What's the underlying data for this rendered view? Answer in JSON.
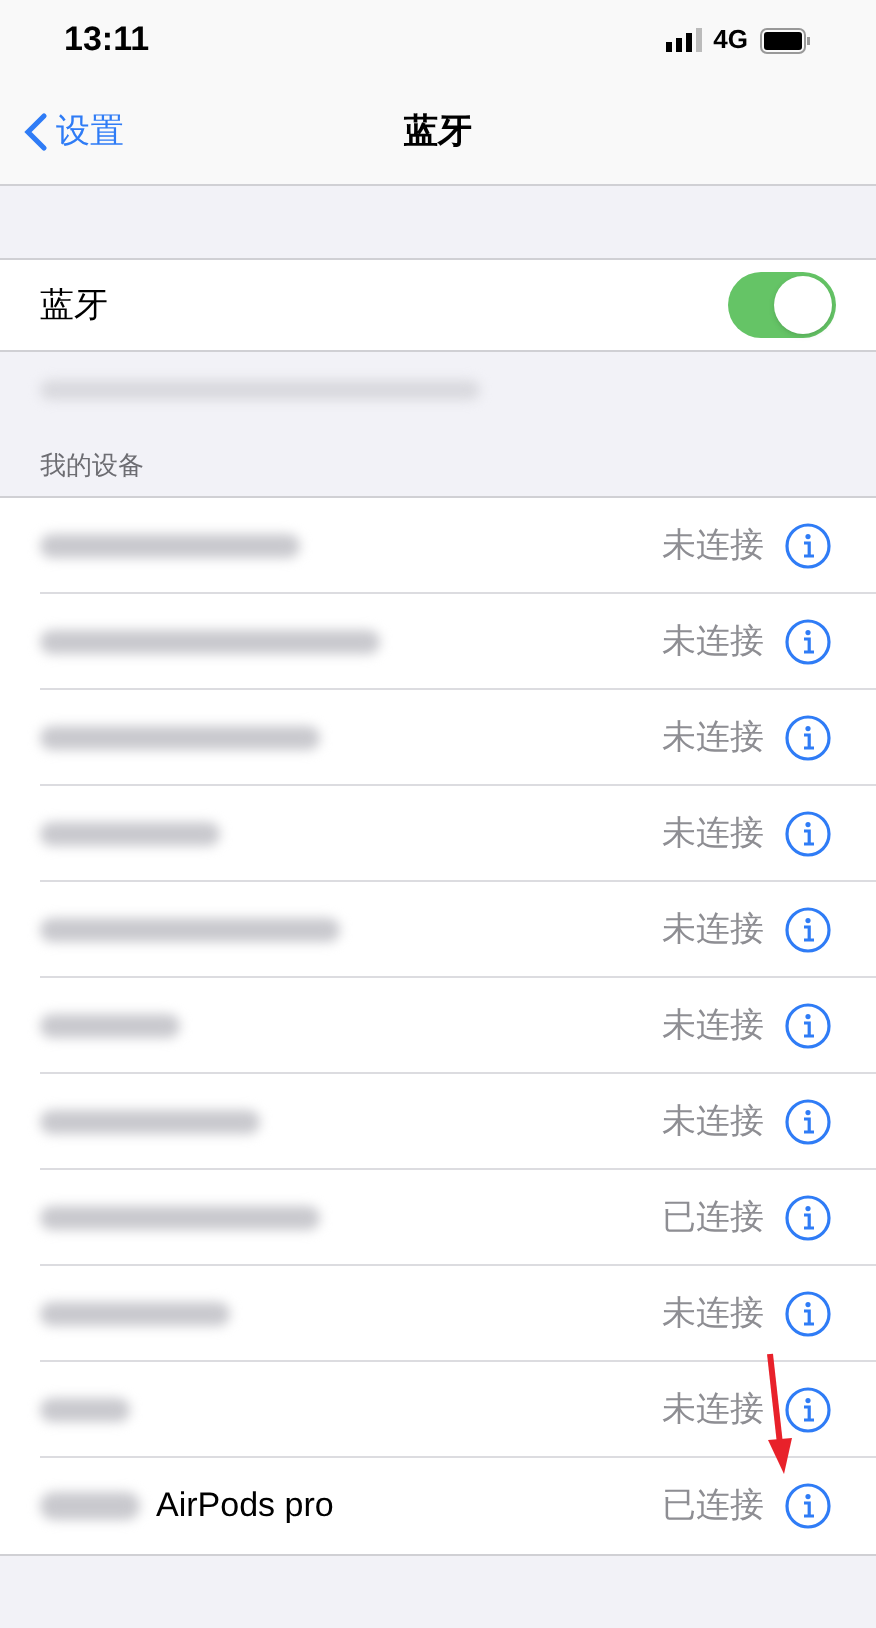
{
  "status_bar": {
    "time": "13:11",
    "network": "4G"
  },
  "nav": {
    "back": "设置",
    "title": "蓝牙"
  },
  "bluetooth": {
    "label": "蓝牙",
    "on": true
  },
  "section_header": "我的设备",
  "devices": [
    {
      "kind": "blurred",
      "status": "未连接"
    },
    {
      "kind": "blurred",
      "status": "未连接"
    },
    {
      "kind": "blurred",
      "status": "未连接"
    },
    {
      "kind": "blurred",
      "status": "未连接"
    },
    {
      "kind": "blurred",
      "status": "未连接"
    },
    {
      "kind": "blurred",
      "status": "未连接"
    },
    {
      "kind": "blurred",
      "status": "未连接"
    },
    {
      "kind": "blurred",
      "status": "已连接"
    },
    {
      "kind": "blurred",
      "status": "未连接"
    },
    {
      "kind": "blurred",
      "status": "未连接"
    },
    {
      "kind": "partial",
      "name": "AirPods pro",
      "status": "已连接"
    }
  ]
}
